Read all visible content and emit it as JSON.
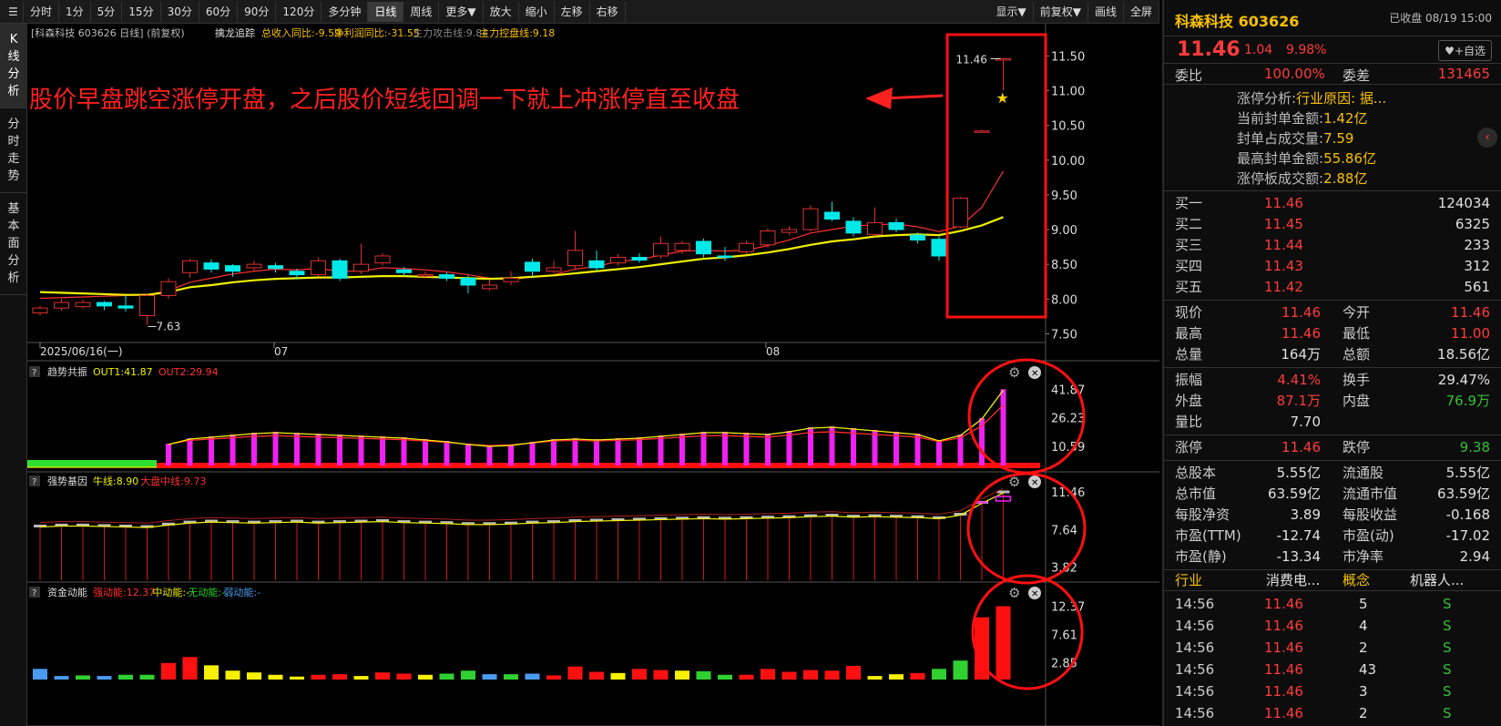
{
  "toolbar": {
    "items": [
      {
        "label": "分时",
        "active": false
      },
      {
        "label": "1分",
        "active": false
      },
      {
        "label": "5分",
        "active": false
      },
      {
        "label": "15分",
        "active": false
      },
      {
        "label": "30分",
        "active": false
      },
      {
        "label": "60分",
        "active": false
      },
      {
        "label": "90分",
        "active": false
      },
      {
        "label": "120分",
        "active": false
      },
      {
        "label": "多分钟",
        "active": false
      },
      {
        "label": "日线",
        "active": true
      },
      {
        "label": "周线",
        "active": false
      },
      {
        "label": "更多▼",
        "active": false
      },
      {
        "label": "放大",
        "active": false
      },
      {
        "label": "缩小",
        "active": false
      },
      {
        "label": "左移",
        "active": false
      },
      {
        "label": "右移",
        "active": false
      }
    ],
    "right": [
      "显示▼",
      "前复权▼",
      "画线",
      "全屏"
    ]
  },
  "leftnav": [
    "K线分析",
    "分时走势",
    "基本面分析"
  ],
  "main_panel": {
    "header": "[科森科技 603626 日线] (前复权)",
    "indicator": "擒龙追踪",
    "metrics": [
      {
        "t": "总收入同比:-9.59",
        "c": "#f8c000"
      },
      {
        "t": "净利润同比:-31.55",
        "c": "#f8c000"
      },
      {
        "t": "主力攻击线:9.84",
        "c": "#888888"
      },
      {
        "t": "主力控盘线:9.18",
        "c": "#f8c000"
      }
    ],
    "y_ticks": [
      "11.50",
      "11.00",
      "10.50",
      "10.00",
      "9.50",
      "9.00",
      "8.50",
      "8.00",
      "7.50"
    ],
    "dates": [
      "2025/06/16(一)",
      "07",
      "08"
    ],
    "annotation": "股价早盘跳空涨停开盘，之后股价短线回调一下就上冲涨停直至收盘",
    "hi_label": "11.46",
    "lo_label": "7.63"
  },
  "chart_data": [
    {
      "type": "candlestick",
      "name": "日线",
      "ylim": [
        7.4,
        11.65
      ],
      "candles": [
        [
          7.8,
          7.87,
          7.76,
          7.9
        ],
        [
          7.87,
          7.95,
          7.83,
          8.0
        ],
        [
          7.89,
          7.95,
          7.86,
          7.99
        ],
        [
          7.95,
          7.9,
          7.84,
          7.97
        ],
        [
          7.9,
          7.87,
          7.82,
          8.05
        ],
        [
          7.76,
          8.05,
          7.63,
          8.08
        ],
        [
          8.05,
          8.25,
          8.0,
          8.3
        ],
        [
          8.38,
          8.55,
          8.31,
          8.58
        ],
        [
          8.52,
          8.43,
          8.38,
          8.57
        ],
        [
          8.48,
          8.4,
          8.32,
          8.5
        ],
        [
          8.45,
          8.5,
          8.4,
          8.55
        ],
        [
          8.48,
          8.44,
          8.38,
          8.52
        ],
        [
          8.4,
          8.35,
          8.28,
          8.44
        ],
        [
          8.35,
          8.55,
          8.32,
          8.6
        ],
        [
          8.55,
          8.3,
          8.26,
          8.58
        ],
        [
          8.4,
          8.5,
          8.36,
          8.8
        ],
        [
          8.52,
          8.62,
          8.48,
          8.66
        ],
        [
          8.42,
          8.38,
          8.33,
          8.46
        ],
        [
          8.33,
          8.35,
          8.29,
          8.4
        ],
        [
          8.35,
          8.3,
          8.26,
          8.38
        ],
        [
          8.3,
          8.2,
          8.08,
          8.34
        ],
        [
          8.15,
          8.2,
          8.12,
          8.28
        ],
        [
          8.25,
          8.3,
          8.2,
          8.4
        ],
        [
          8.53,
          8.4,
          8.32,
          8.58
        ],
        [
          8.4,
          8.45,
          8.37,
          8.55
        ],
        [
          8.48,
          8.7,
          8.44,
          8.98
        ],
        [
          8.55,
          8.45,
          8.4,
          8.7
        ],
        [
          8.52,
          8.6,
          8.48,
          8.65
        ],
        [
          8.6,
          8.56,
          8.52,
          8.66
        ],
        [
          8.62,
          8.8,
          8.58,
          8.9
        ],
        [
          8.7,
          8.8,
          8.65,
          8.84
        ],
        [
          8.83,
          8.65,
          8.6,
          8.87
        ],
        [
          8.62,
          8.6,
          8.55,
          8.75
        ],
        [
          8.68,
          8.8,
          8.64,
          8.84
        ],
        [
          8.78,
          8.98,
          8.74,
          9.02
        ],
        [
          8.96,
          9.0,
          8.92,
          9.05
        ],
        [
          9.0,
          9.3,
          8.97,
          9.35
        ],
        [
          9.25,
          9.15,
          9.12,
          9.4
        ],
        [
          9.12,
          8.95,
          8.9,
          9.18
        ],
        [
          8.93,
          9.1,
          8.9,
          9.32
        ],
        [
          9.1,
          9.0,
          8.96,
          9.16
        ],
        [
          8.92,
          8.85,
          8.8,
          8.96
        ],
        [
          8.86,
          8.62,
          8.55,
          8.9
        ],
        [
          9.04,
          9.45,
          9.02,
          9.47
        ],
        [
          10.42,
          10.42,
          10.42,
          10.44
        ],
        [
          11.46,
          11.46,
          11.0,
          11.46
        ]
      ],
      "ma": [
        {
          "name": "主力攻击线",
          "color": "#ff3030",
          "values": [
            8.01,
            8.02,
            8.03,
            8.04,
            8.05,
            8.06,
            8.12,
            8.24,
            8.3,
            8.36,
            8.4,
            8.43,
            8.42,
            8.44,
            8.4,
            8.4,
            8.45,
            8.44,
            8.42,
            8.39,
            8.35,
            8.3,
            8.28,
            8.32,
            8.35,
            8.43,
            8.47,
            8.54,
            8.57,
            8.63,
            8.69,
            8.7,
            8.69,
            8.7,
            8.77,
            8.85,
            8.95,
            9.0,
            9.05,
            9.07,
            9.08,
            9.04,
            8.97,
            9.05,
            9.32,
            9.84
          ]
        },
        {
          "name": "主力控盘线",
          "color": "#f0f000",
          "values": [
            8.1,
            8.09,
            8.08,
            8.07,
            8.06,
            8.06,
            8.1,
            8.17,
            8.2,
            8.24,
            8.27,
            8.29,
            8.3,
            8.31,
            8.31,
            8.32,
            8.33,
            8.33,
            8.32,
            8.31,
            8.3,
            8.29,
            8.3,
            8.32,
            8.34,
            8.37,
            8.4,
            8.43,
            8.46,
            8.5,
            8.54,
            8.58,
            8.6,
            8.63,
            8.67,
            8.72,
            8.78,
            8.83,
            8.86,
            8.9,
            8.92,
            8.93,
            8.92,
            8.98,
            9.06,
            9.18
          ]
        }
      ]
    },
    {
      "type": "bar",
      "name": "趋势共振",
      "series": [
        {
          "name": "OUT1",
          "value": 41.87
        },
        {
          "name": "OUT2",
          "value": 29.94
        }
      ],
      "ylim": [
        0,
        45
      ],
      "ticks": [
        "41.87",
        "26.23",
        "10.59"
      ],
      "values": [
        10,
        10,
        10,
        10,
        10,
        10,
        12,
        15,
        16,
        17,
        18,
        18.5,
        18,
        17.5,
        17,
        16.5,
        16,
        15.5,
        14.5,
        13.5,
        12,
        11,
        11.5,
        13,
        14.5,
        15,
        14.5,
        15,
        15.5,
        16.5,
        17.5,
        18.5,
        18.5,
        18,
        17.5,
        19,
        21,
        21.5,
        20.5,
        19.5,
        18.5,
        17.5,
        14,
        17,
        26,
        41.87
      ]
    },
    {
      "type": "bar",
      "name": "强势基因",
      "series": [
        {
          "name": "牛线",
          "value": 8.9
        },
        {
          "name": "大盘中线",
          "value": 9.73
        }
      ],
      "ylim": [
        2.5,
        12.2
      ],
      "ticks": [
        "11.46",
        "7.64",
        "3.82"
      ],
      "values": [
        8.0,
        8.1,
        8.1,
        8.05,
        8.0,
        7.95,
        8.2,
        8.4,
        8.5,
        8.45,
        8.4,
        8.45,
        8.5,
        8.4,
        8.45,
        8.5,
        8.55,
        8.45,
        8.4,
        8.35,
        8.25,
        8.25,
        8.3,
        8.4,
        8.45,
        8.55,
        8.6,
        8.65,
        8.7,
        8.75,
        8.8,
        8.85,
        8.8,
        8.85,
        8.9,
        8.95,
        9.05,
        9.1,
        9.0,
        9.05,
        9.0,
        8.95,
        8.85,
        9.2,
        10.4,
        11.46
      ]
    },
    {
      "type": "bar",
      "name": "资金动能",
      "series": [
        {
          "name": "强动能",
          "value": 12.37
        },
        {
          "name": "中动能",
          "value": null
        },
        {
          "name": "无动能",
          "value": null
        },
        {
          "name": "弱动能",
          "value": null
        }
      ],
      "ylim": [
        0,
        12.6
      ],
      "ticks": [
        "12.37",
        "7.61",
        "2.85"
      ],
      "values": [
        1.8,
        0.6,
        0.7,
        0.6,
        0.8,
        0.8,
        2.8,
        3.8,
        2.4,
        1.5,
        1.2,
        0.8,
        0.5,
        0.8,
        0.9,
        0.6,
        1.2,
        1.0,
        0.8,
        1.0,
        1.5,
        0.9,
        0.9,
        1.0,
        0.7,
        2.2,
        1.3,
        1.1,
        1.8,
        1.6,
        1.5,
        1.4,
        0.8,
        0.8,
        1.8,
        1.3,
        1.6,
        1.5,
        2.3,
        0.6,
        0.9,
        1.1,
        1.8,
        3.2,
        10.5,
        12.37
      ],
      "colors": [
        "#4a9bf0",
        "#4a9bf0",
        "#30d030",
        "#4a9bf0",
        "#30d030",
        "#30d030",
        "#ff1010",
        "#ff1010",
        "#f8f000",
        "#f8f000",
        "#f8f000",
        "#f8f000",
        "#f8f000",
        "#ff1010",
        "#ff1010",
        "#f8f000",
        "#ff1010",
        "#ff1010",
        "#f8f000",
        "#30d030",
        "#30d030",
        "#4a9bf0",
        "#30d030",
        "#4a9bf0",
        "#ff1010",
        "#ff1010",
        "#ff1010",
        "#f8f000",
        "#ff1010",
        "#ff1010",
        "#f8f000",
        "#30d030",
        "#30d030",
        "#ff1010",
        "#ff1010",
        "#ff1010",
        "#ff1010",
        "#ff1010",
        "#ff1010",
        "#f8f000",
        "#f8f000",
        "#ff1010",
        "#30d030",
        "#30d030",
        "#ff1010",
        "#ff1010"
      ]
    }
  ],
  "sub_headers": [
    {
      "name": "趋势共振",
      "parts": [
        {
          "t": "OUT1:41.87",
          "c": "#f0f000"
        },
        {
          "t": "OUT2:29.94",
          "c": "#ff3030"
        }
      ]
    },
    {
      "name": "强势基因",
      "parts": [
        {
          "t": "牛线:8.90",
          "c": "#f0f000"
        },
        {
          "t": "大盘中线:9.73",
          "c": "#ff3030"
        }
      ]
    },
    {
      "name": "资金动能",
      "parts": [
        {
          "t": "强动能:12.37",
          "c": "#ff3030"
        },
        {
          "t": "中动能:-",
          "c": "#f0f000"
        },
        {
          "t": "无动能:-",
          "c": "#30d030"
        },
        {
          "t": "弱动能:-",
          "c": "#4a9bf0"
        }
      ]
    }
  ],
  "quote": {
    "name": "科森科技 603626",
    "status": "已收盘 08/19 15:00",
    "price": "11.46",
    "change": "1.04",
    "pct": "9.98%",
    "fav": "+自选",
    "weibi_label": "委比",
    "weibi": "100.00%",
    "weicha_label": "委差",
    "weicha": "131465",
    "limit_info": [
      {
        "k": "涨停分析:",
        "v": "行业原因: 据..."
      },
      {
        "k": "当前封单金额:",
        "v": "1.42亿"
      },
      {
        "k": "封单占成交量:",
        "v": "7.59"
      },
      {
        "k": "最高封单金额:",
        "v": "55.86亿"
      },
      {
        "k": "涨停板成交额:",
        "v": "2.88亿"
      }
    ],
    "bids": [
      {
        "label": "买一",
        "price": "11.46",
        "vol": "124034"
      },
      {
        "label": "买二",
        "price": "11.45",
        "vol": "6325"
      },
      {
        "label": "买三",
        "price": "11.44",
        "vol": "233"
      },
      {
        "label": "买四",
        "price": "11.43",
        "vol": "312"
      },
      {
        "label": "买五",
        "price": "11.42",
        "vol": "561"
      }
    ],
    "stats1": [
      [
        {
          "k": "现价",
          "v": "11.46",
          "c": "red"
        },
        {
          "k": "今开",
          "v": "11.46",
          "c": "red"
        }
      ],
      [
        {
          "k": "最高",
          "v": "11.46",
          "c": "red"
        },
        {
          "k": "最低",
          "v": "11.00",
          "c": "red"
        }
      ],
      [
        {
          "k": "总量",
          "v": "164万",
          "c": "wht"
        },
        {
          "k": "总额",
          "v": "18.56亿",
          "c": "wht"
        }
      ]
    ],
    "stats2": [
      [
        {
          "k": "振幅",
          "v": "4.41%",
          "c": "red"
        },
        {
          "k": "换手",
          "v": "29.47%",
          "c": "wht"
        }
      ],
      [
        {
          "k": "外盘",
          "v": "87.1万",
          "c": "red"
        },
        {
          "k": "内盘",
          "v": "76.9万",
          "c": "grn"
        }
      ],
      [
        {
          "k": "量比",
          "v": "7.70",
          "c": "wht"
        },
        {
          "k": "",
          "v": "",
          "c": "wht"
        }
      ]
    ],
    "stats3": [
      [
        {
          "k": "涨停",
          "v": "11.46",
          "c": "red"
        },
        {
          "k": "跌停",
          "v": "9.38",
          "c": "grn"
        }
      ]
    ],
    "stats4": [
      [
        {
          "k": "总股本",
          "v": "5.55亿",
          "c": "wht"
        },
        {
          "k": "流通股",
          "v": "5.55亿",
          "c": "wht"
        }
      ],
      [
        {
          "k": "总市值",
          "v": "63.59亿",
          "c": "wht"
        },
        {
          "k": "流通市值",
          "v": "63.59亿",
          "c": "wht"
        }
      ],
      [
        {
          "k": "每股净资",
          "v": "3.89",
          "c": "wht"
        },
        {
          "k": "每股收益",
          "v": "-0.168",
          "c": "wht"
        }
      ],
      [
        {
          "k": "市盈(TTM)",
          "v": "-12.74",
          "c": "wht"
        },
        {
          "k": "市盈(动)",
          "v": "-17.02",
          "c": "wht"
        }
      ],
      [
        {
          "k": "市盈(静)",
          "v": "-13.34",
          "c": "wht"
        },
        {
          "k": "市净率",
          "v": "2.94",
          "c": "wht"
        }
      ]
    ],
    "industry": {
      "k1": "行业",
      "v1": "消费电...",
      "k2": "概念",
      "v2": "机器人..."
    },
    "ticks": [
      {
        "t": "14:56",
        "p": "11.46",
        "v": "5",
        "s": "S"
      },
      {
        "t": "14:56",
        "p": "11.46",
        "v": "4",
        "s": "S"
      },
      {
        "t": "14:56",
        "p": "11.46",
        "v": "2",
        "s": "S"
      },
      {
        "t": "14:56",
        "p": "11.46",
        "v": "43",
        "s": "S"
      },
      {
        "t": "14:56",
        "p": "11.46",
        "v": "3",
        "s": "S"
      },
      {
        "t": "14:56",
        "p": "11.46",
        "v": "2",
        "s": "S"
      }
    ]
  },
  "colors": {
    "up": "#e03030",
    "down": "#00e8e8",
    "accent": "#f8c000",
    "annotation": "#ff2020"
  }
}
